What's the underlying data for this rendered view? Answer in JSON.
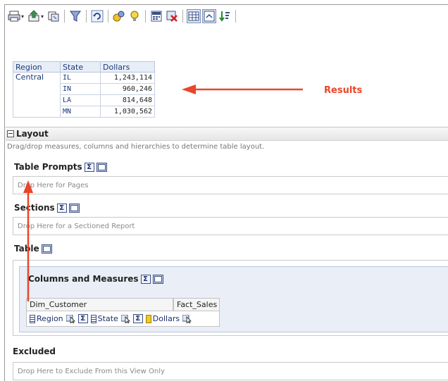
{
  "toolbar": {
    "icons": [
      "print-icon",
      "export-icon",
      "copy-icon",
      "filter-icon",
      "refresh-icon",
      "group-icon",
      "help-icon",
      "calc-icon",
      "remove-icon",
      "table-view-icon",
      "format-icon",
      "sort-icon"
    ]
  },
  "results": {
    "headers": [
      "Region",
      "State",
      "Dollars"
    ],
    "region": "Central",
    "rows": [
      {
        "state": "IL",
        "dollars": "1,243,114"
      },
      {
        "state": "IN",
        "dollars": "960,246"
      },
      {
        "state": "LA",
        "dollars": "814,648"
      },
      {
        "state": "MN",
        "dollars": "1,030,562"
      }
    ],
    "annotation_label": "Results",
    "annotation_color": "#e8462a"
  },
  "layout": {
    "title": "Layout",
    "description": "Drag/drop measures, columns and hierarchies to determine table layout.",
    "table_prompts": {
      "title": "Table Prompts",
      "drop": "Drop Here for Pages"
    },
    "sections": {
      "title": "Sections",
      "drop": "Drop Here for a Sectioned Report"
    },
    "table": {
      "title": "Table"
    },
    "columns_measures": {
      "title": "Columns and Measures",
      "dim_header": "Dim_Customer",
      "fact_header": "Fact_Sales",
      "columns": [
        {
          "label": "Region",
          "type": "column"
        },
        {
          "label": "State",
          "type": "column"
        },
        {
          "label": "Dollars",
          "type": "measure"
        }
      ]
    },
    "excluded": {
      "title": "Excluded",
      "drop": "Drop Here to Exclude From this View Only"
    }
  },
  "sum_symbol": "Σ"
}
